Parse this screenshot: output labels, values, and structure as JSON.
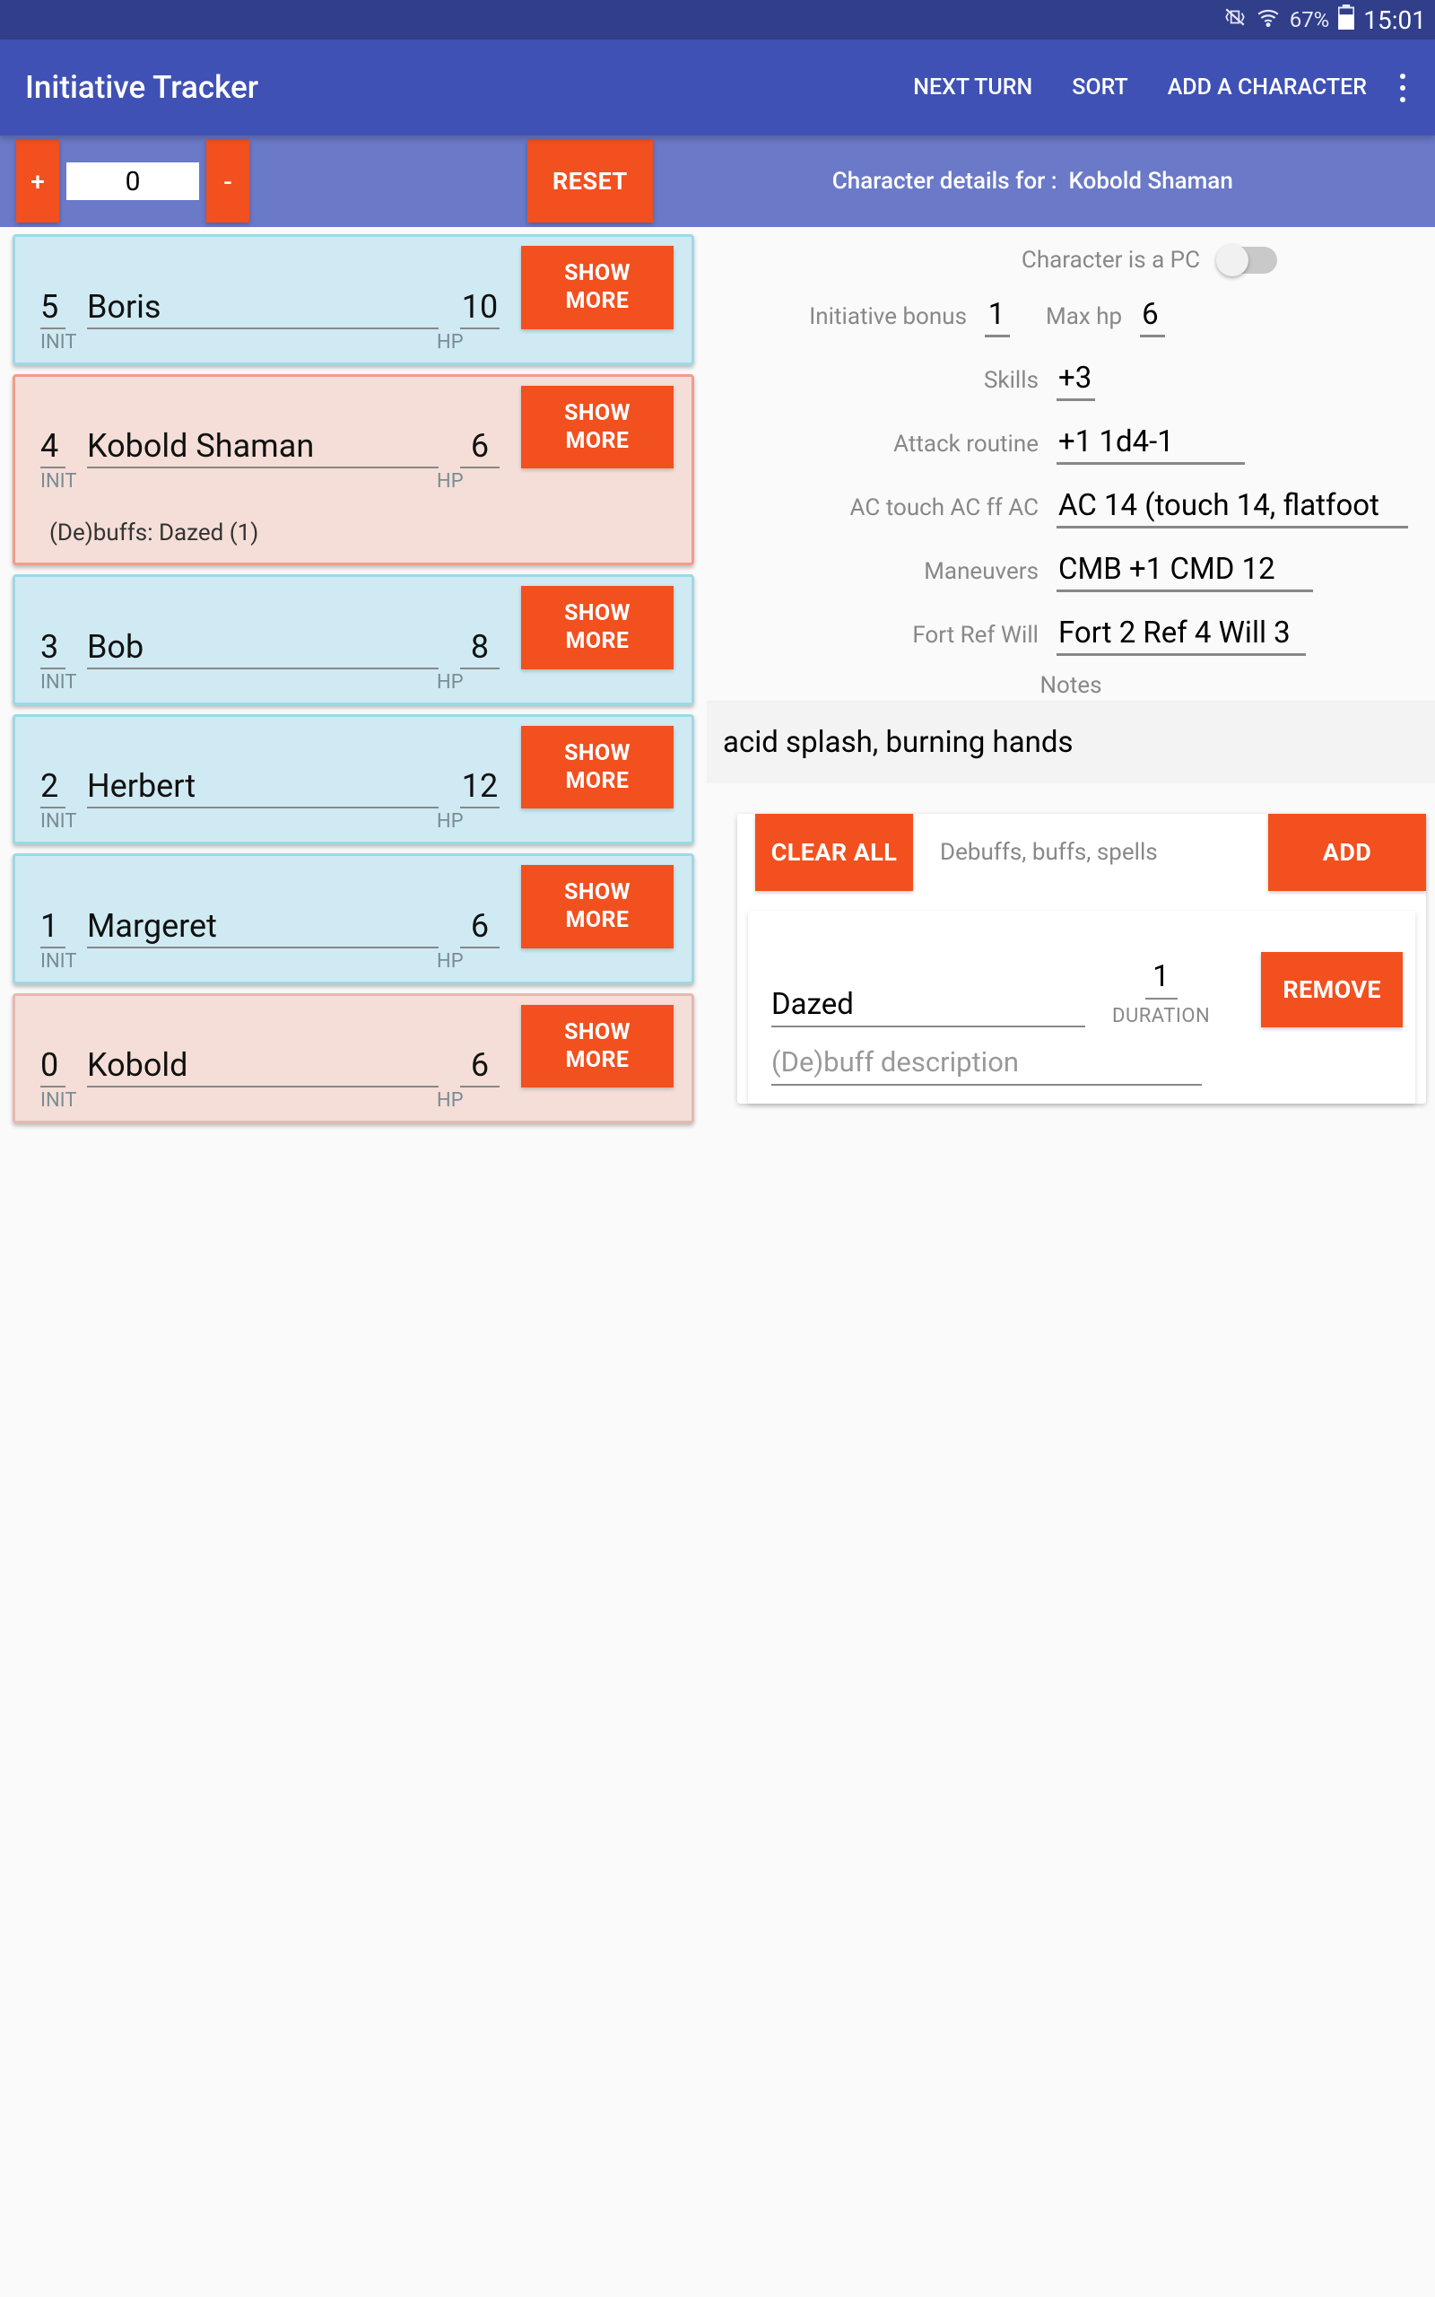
{
  "status": {
    "battery_pct": "67%",
    "time": "15:01"
  },
  "app": {
    "title": "Initiative Tracker",
    "actions": {
      "next_turn": "NEXT TURN",
      "sort": "SORT",
      "add_character": "ADD A CHARACTER"
    }
  },
  "toolbar": {
    "plus": "+",
    "minus": "-",
    "value": "0",
    "reset": "RESET",
    "details_prefix": "Character details for :",
    "details_name": "Kobold Shaman"
  },
  "labels": {
    "init": "INIT",
    "hp": "HP",
    "show_more": "SHOW MORE"
  },
  "characters": [
    {
      "init": "5",
      "name": "Boris",
      "hp": "10",
      "color": "blue"
    },
    {
      "init": "4",
      "name": "Kobold Shaman",
      "hp": "6",
      "color": "pink",
      "debuffs": "(De)buffs: Dazed (1)"
    },
    {
      "init": "3",
      "name": "Bob",
      "hp": "8",
      "color": "blue"
    },
    {
      "init": "2",
      "name": "Herbert",
      "hp": "12",
      "color": "blue"
    },
    {
      "init": "1",
      "name": "Margeret",
      "hp": "6",
      "color": "blue"
    },
    {
      "init": "0",
      "name": "Kobold",
      "hp": "6",
      "color": "pink dim"
    }
  ],
  "details": {
    "pc_label": "Character is a PC",
    "init_bonus_label": "Initiative bonus",
    "init_bonus": "1",
    "maxhp_label": "Max hp",
    "maxhp": "6",
    "skills_label": "Skills",
    "skills": "+3",
    "attack_label": "Attack routine",
    "attack": "+1 1d4-1",
    "ac_label": "AC touch AC ff AC",
    "ac": "AC 14 (touch 14, flatfoot",
    "maneuvers_label": "Maneuvers",
    "maneuvers": "CMB +1 CMD 12",
    "saves_label": "Fort Ref Will",
    "saves": "Fort 2 Ref 4 Will 3",
    "notes_label": "Notes",
    "notes": "acid splash, burning hands"
  },
  "buffs": {
    "clear_all": "CLEAR ALL",
    "title": "Debuffs, buffs, spells",
    "add": "ADD",
    "item": {
      "name": "Dazed",
      "duration": "1",
      "duration_label": "DURATION",
      "remove": "REMOVE",
      "desc_placeholder": "(De)buff description"
    }
  }
}
